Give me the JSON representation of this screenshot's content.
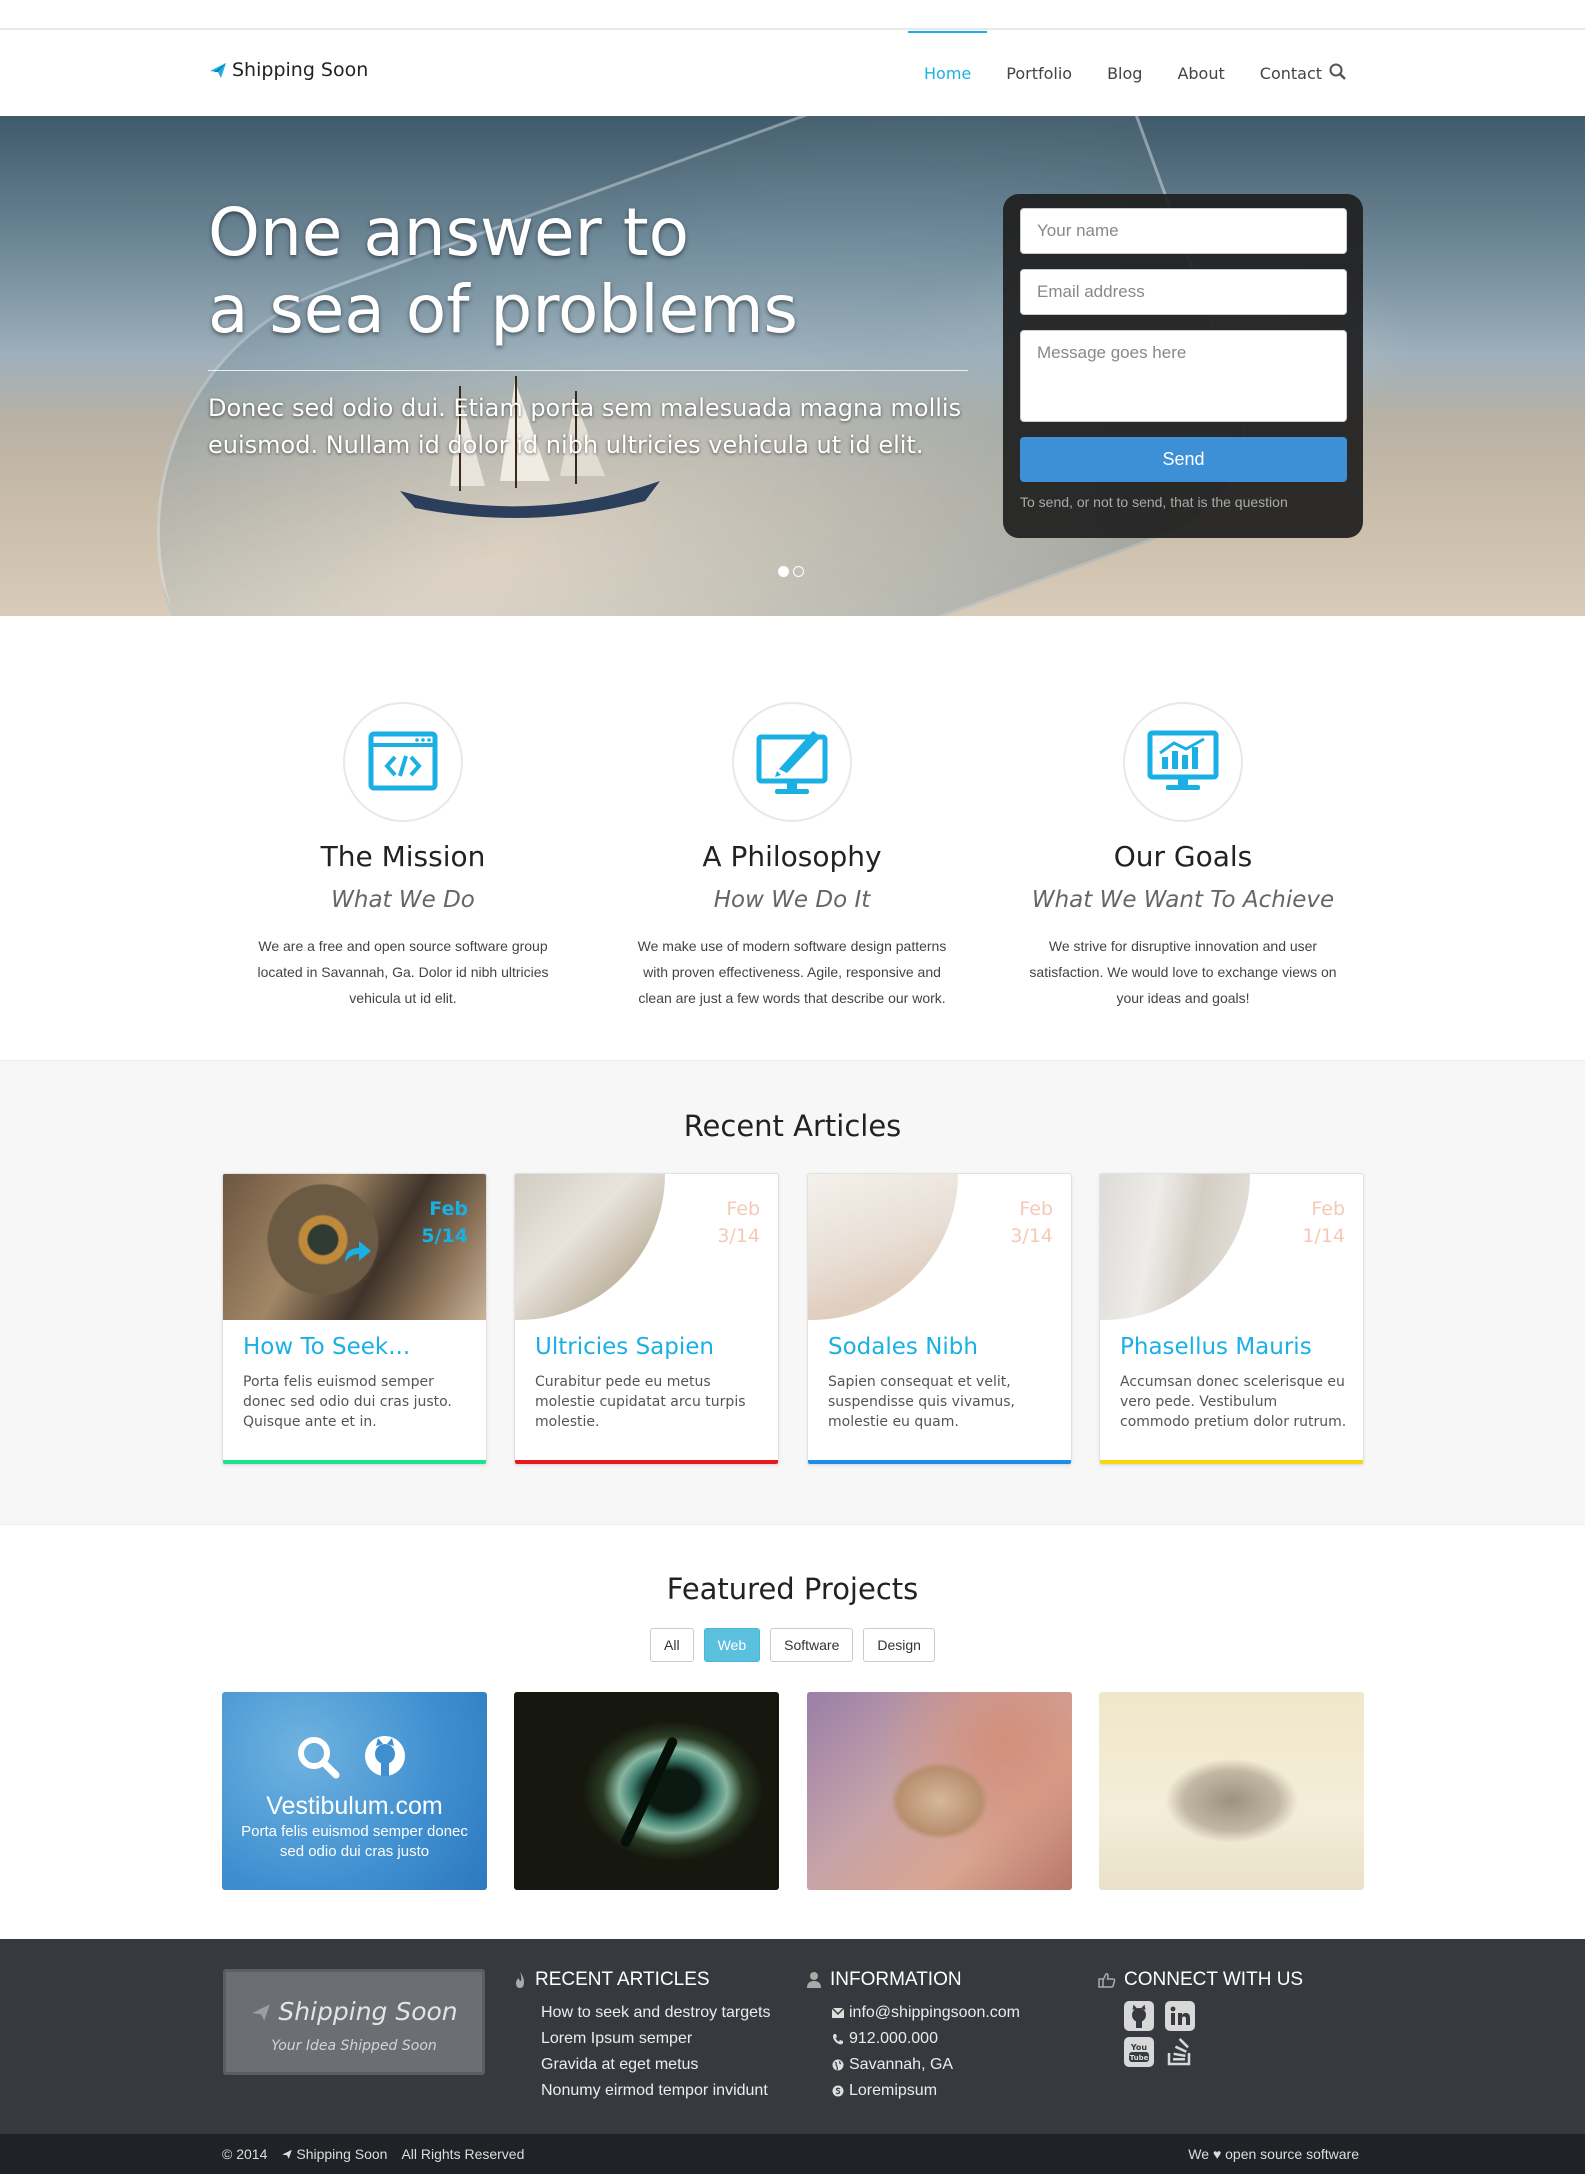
{
  "brand": {
    "name": "Shipping Soon",
    "tagline": "Your Idea Shipped Soon",
    "accent": "#1ab0e4"
  },
  "nav": {
    "items": [
      {
        "label": "Home",
        "active": true
      },
      {
        "label": "Portfolio"
      },
      {
        "label": "Blog"
      },
      {
        "label": "About"
      },
      {
        "label": "Contact"
      }
    ],
    "search_icon": "search-icon"
  },
  "hero": {
    "title_line1": "One answer to",
    "title_line2": "a sea of problems",
    "lead": "Donec sed odio dui. Etiam porta sem malesuada magna mollis euismod. Nullam id dolor id nibh ultricies vehicula ut id elit.",
    "slides": 2,
    "active_slide": 1,
    "form": {
      "name_placeholder": "Your name",
      "email_placeholder": "Email address",
      "message_placeholder": "Message goes here",
      "send_label": "Send",
      "note": "To send, or not to send, that is the question"
    }
  },
  "features": [
    {
      "icon": "code-window-icon",
      "title": "The Mission",
      "subtitle": "What We Do",
      "text": "We are a free and open source software group located in Savannah, Ga. Dolor id nibh ultricies vehicula ut id elit."
    },
    {
      "icon": "monitor-pen-icon",
      "title": "A Philosophy",
      "subtitle": "How We Do It",
      "text": "We make use of modern software design patterns with proven effectiveness. Agile, responsive and clean are just a few words that describe our work."
    },
    {
      "icon": "monitor-chart-icon",
      "title": "Our Goals",
      "subtitle": "What We Want To Achieve",
      "text": "We strive for disruptive innovation and user satisfaction. We would love to exchange views on your ideas and goals!"
    }
  ],
  "articles": {
    "title": "Recent Articles",
    "items": [
      {
        "title": "How To Seek...",
        "month": "Feb",
        "day": "5/14",
        "text": "Porta felis euismod semper donec sed odio dui cras justo. Quisque ante et in.",
        "bar_color": "#1de38e"
      },
      {
        "title": "Ultricies Sapien",
        "month": "Feb",
        "day": "3/14",
        "text": "Curabitur pede eu metus molestie cupidatat arcu turpis molestie.",
        "bar_color": "#e8191e"
      },
      {
        "title": "Sodales Nibh",
        "month": "Feb",
        "day": "3/14",
        "text": "Sapien consequat et velit, suspendisse quis vivamus, molestie eu quam.",
        "bar_color": "#1f8ee8"
      },
      {
        "title": "Phasellus Mauris",
        "month": "Feb",
        "day": "1/14",
        "text": "Accumsan donec scelerisque eu vero pede. Vestibulum commodo pretium dolor rutrum.",
        "bar_color": "#f5d90e"
      }
    ]
  },
  "projects": {
    "title": "Featured Projects",
    "filters": [
      {
        "label": "All"
      },
      {
        "label": "Web",
        "active": true
      },
      {
        "label": "Software"
      },
      {
        "label": "Design"
      }
    ],
    "featured": {
      "name": "Vestibulum.com",
      "text": "Porta felis euismod semper donec sed odio dui cras justo"
    }
  },
  "footer": {
    "recent": {
      "heading": "RECENT ARTICLES",
      "links": [
        "How to seek and destroy targets",
        "Lorem Ipsum semper",
        "Gravida at eget metus",
        "Nonumy eirmod tempor invidunt"
      ]
    },
    "info": {
      "heading": "INFORMATION",
      "email": "info@shippingsoon.com",
      "phone": "912.000.000",
      "location": "Savannah, GA",
      "skype": "Loremipsum"
    },
    "connect": {
      "heading": "CONNECT WITH US",
      "networks": [
        "github-icon",
        "linkedin-icon",
        "youtube-icon",
        "stackoverflow-icon"
      ]
    },
    "year": "© 2014",
    "rights": "All Rights Reserved",
    "love_pre": "We",
    "love_post": "open source software"
  }
}
